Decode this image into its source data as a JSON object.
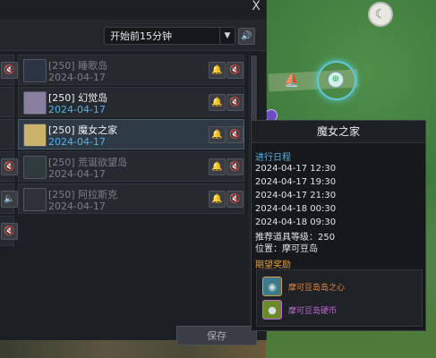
{
  "window": {
    "close_label": "X",
    "filter": {
      "selected": "开始前15分钟"
    },
    "save_label": "保存"
  },
  "rows": [
    {
      "name": "[250] 睡歌岛",
      "date": "2024-04-17",
      "state": "dim",
      "thumb_color": "#2c3544"
    },
    {
      "name": "[250] 幻觉岛",
      "date": "2024-04-17",
      "state": "active",
      "thumb_color": "#8a7fa0"
    },
    {
      "name": "[250] 魔女之家",
      "date": "2024-04-17",
      "state": "selected",
      "thumb_color": "#c9b36a"
    },
    {
      "name": "[250] 荒诞欲望岛",
      "date": "2024-04-17",
      "state": "dim",
      "thumb_color": "#2f3a3a"
    },
    {
      "name": "[250] 阿拉斯克",
      "date": "2024-04-17",
      "state": "dim",
      "thumb_color": "#2c3238"
    }
  ],
  "tooltip": {
    "title": "魔女之家",
    "schedule_label": "进行日程",
    "schedule": [
      "2024-04-17 12:30",
      "2024-04-17 19:30",
      "2024-04-17 21:30",
      "2024-04-18 00:30",
      "2024-04-18 09:30"
    ],
    "recommended": "推荐道具等级：250",
    "location": "位置：摩可豆岛",
    "rewards_label": "期望奖励",
    "rewards": [
      {
        "name": "摩可豆岛岛之心",
        "color": "#e8863b",
        "icon_bg": "#3a7a8a"
      },
      {
        "name": "摩可豆岛硬币",
        "color": "#c06bd8",
        "icon_bg": "#6a8a2a"
      }
    ]
  },
  "colors": {
    "accent_blue": "#4fb4e8",
    "accent_orange": "#e6a13b",
    "mute_red": "#dd4444"
  }
}
